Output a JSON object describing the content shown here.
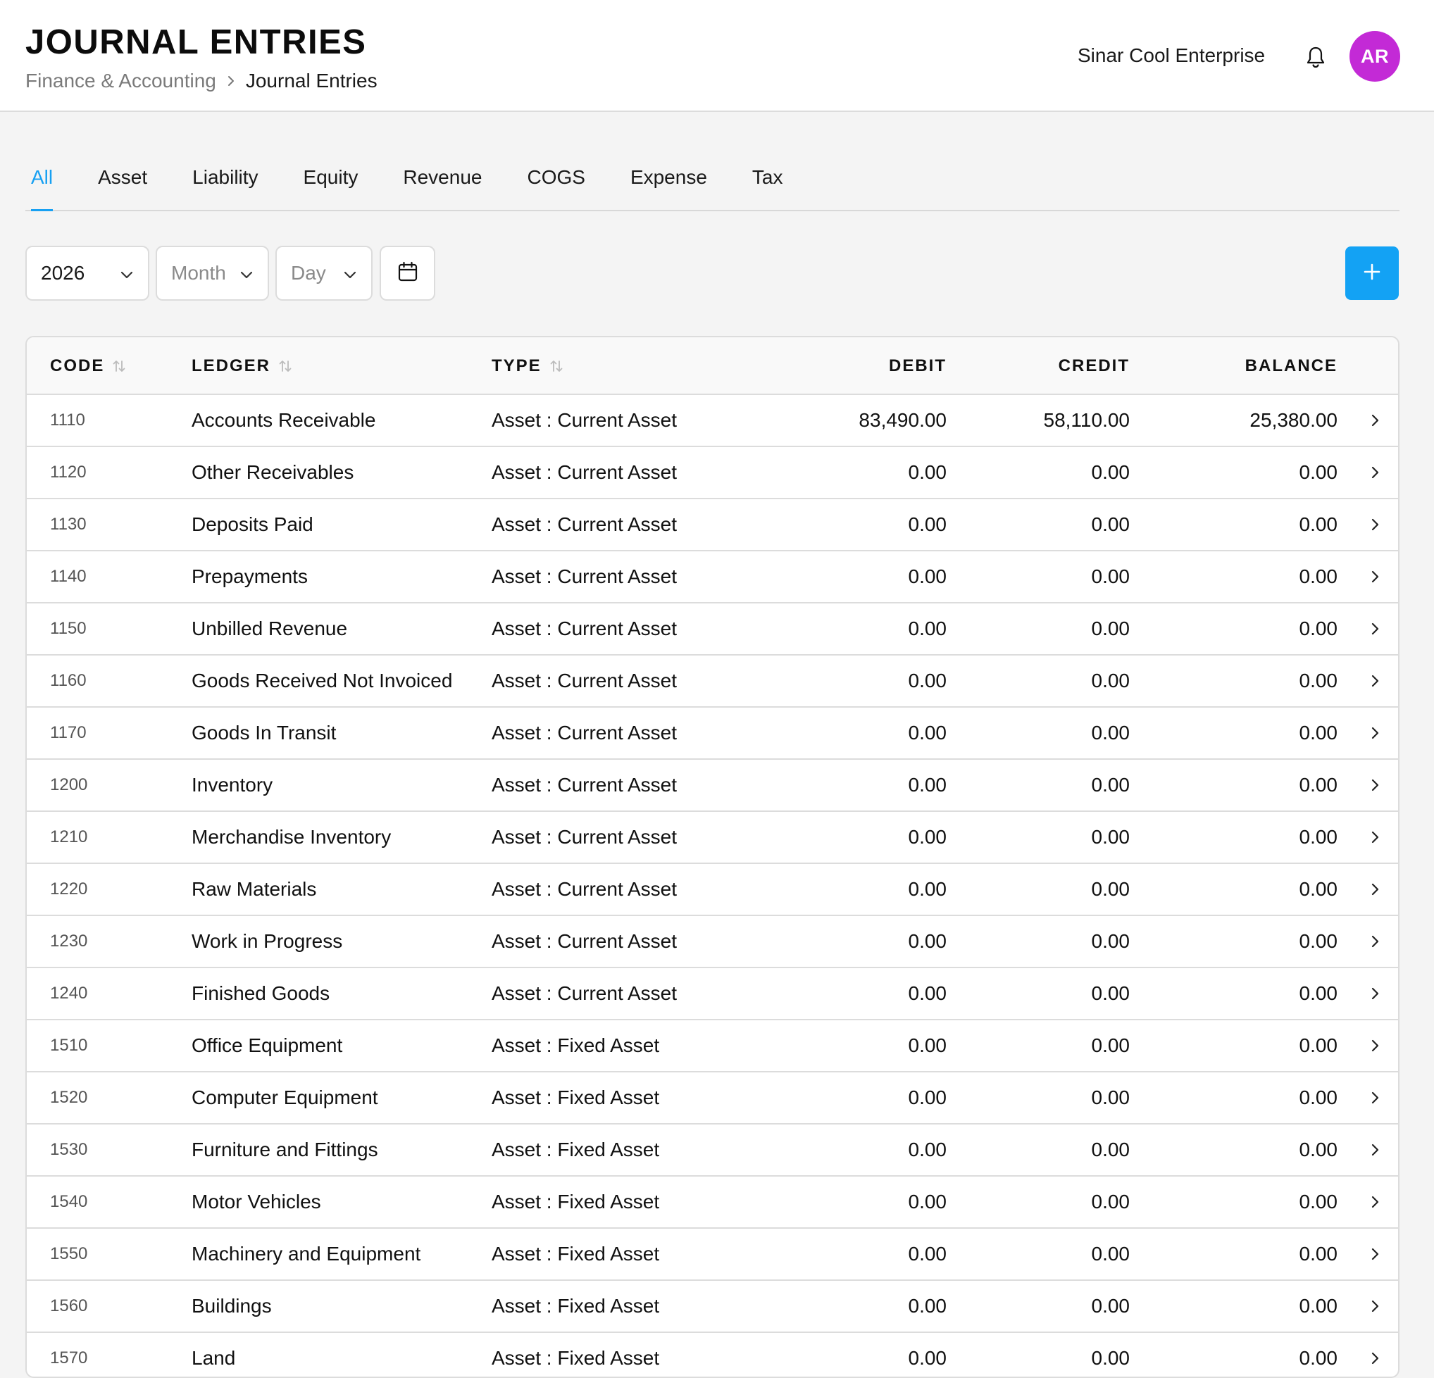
{
  "header": {
    "title": "JOURNAL ENTRIES",
    "breadcrumb": {
      "parent": "Finance & Accounting",
      "current": "Journal Entries"
    },
    "company": "Sinar Cool Enterprise",
    "avatar_initials": "AR",
    "avatar_color": "#c32ad6"
  },
  "tabs": [
    {
      "label": "All",
      "active": true
    },
    {
      "label": "Asset"
    },
    {
      "label": "Liability"
    },
    {
      "label": "Equity"
    },
    {
      "label": "Revenue"
    },
    {
      "label": "COGS"
    },
    {
      "label": "Expense"
    },
    {
      "label": "Tax"
    }
  ],
  "filters": {
    "year": "2026",
    "month_placeholder": "Month",
    "day_placeholder": "Day"
  },
  "accent_color": "#13a2f4",
  "table": {
    "columns": {
      "code": "CODE",
      "ledger": "LEDGER",
      "type": "TYPE",
      "debit": "DEBIT",
      "credit": "CREDIT",
      "balance": "BALANCE"
    },
    "rows": [
      {
        "code": "1110",
        "ledger": "Accounts Receivable",
        "type": "Asset : Current Asset",
        "debit": "83,490.00",
        "credit": "58,110.00",
        "balance": "25,380.00"
      },
      {
        "code": "1120",
        "ledger": "Other Receivables",
        "type": "Asset : Current Asset",
        "debit": "0.00",
        "credit": "0.00",
        "balance": "0.00"
      },
      {
        "code": "1130",
        "ledger": "Deposits Paid",
        "type": "Asset : Current Asset",
        "debit": "0.00",
        "credit": "0.00",
        "balance": "0.00"
      },
      {
        "code": "1140",
        "ledger": "Prepayments",
        "type": "Asset : Current Asset",
        "debit": "0.00",
        "credit": "0.00",
        "balance": "0.00"
      },
      {
        "code": "1150",
        "ledger": "Unbilled Revenue",
        "type": "Asset : Current Asset",
        "debit": "0.00",
        "credit": "0.00",
        "balance": "0.00"
      },
      {
        "code": "1160",
        "ledger": "Goods Received Not Invoiced",
        "type": "Asset : Current Asset",
        "debit": "0.00",
        "credit": "0.00",
        "balance": "0.00"
      },
      {
        "code": "1170",
        "ledger": "Goods In Transit",
        "type": "Asset : Current Asset",
        "debit": "0.00",
        "credit": "0.00",
        "balance": "0.00"
      },
      {
        "code": "1200",
        "ledger": "Inventory",
        "type": "Asset : Current Asset",
        "debit": "0.00",
        "credit": "0.00",
        "balance": "0.00"
      },
      {
        "code": "1210",
        "ledger": "Merchandise Inventory",
        "type": "Asset : Current Asset",
        "debit": "0.00",
        "credit": "0.00",
        "balance": "0.00"
      },
      {
        "code": "1220",
        "ledger": "Raw Materials",
        "type": "Asset : Current Asset",
        "debit": "0.00",
        "credit": "0.00",
        "balance": "0.00"
      },
      {
        "code": "1230",
        "ledger": "Work in Progress",
        "type": "Asset : Current Asset",
        "debit": "0.00",
        "credit": "0.00",
        "balance": "0.00"
      },
      {
        "code": "1240",
        "ledger": "Finished Goods",
        "type": "Asset : Current Asset",
        "debit": "0.00",
        "credit": "0.00",
        "balance": "0.00"
      },
      {
        "code": "1510",
        "ledger": "Office Equipment",
        "type": "Asset : Fixed Asset",
        "debit": "0.00",
        "credit": "0.00",
        "balance": "0.00"
      },
      {
        "code": "1520",
        "ledger": "Computer Equipment",
        "type": "Asset : Fixed Asset",
        "debit": "0.00",
        "credit": "0.00",
        "balance": "0.00"
      },
      {
        "code": "1530",
        "ledger": "Furniture and Fittings",
        "type": "Asset : Fixed Asset",
        "debit": "0.00",
        "credit": "0.00",
        "balance": "0.00"
      },
      {
        "code": "1540",
        "ledger": "Motor Vehicles",
        "type": "Asset : Fixed Asset",
        "debit": "0.00",
        "credit": "0.00",
        "balance": "0.00"
      },
      {
        "code": "1550",
        "ledger": "Machinery and Equipment",
        "type": "Asset : Fixed Asset",
        "debit": "0.00",
        "credit": "0.00",
        "balance": "0.00"
      },
      {
        "code": "1560",
        "ledger": "Buildings",
        "type": "Asset : Fixed Asset",
        "debit": "0.00",
        "credit": "0.00",
        "balance": "0.00"
      },
      {
        "code": "1570",
        "ledger": "Land",
        "type": "Asset : Fixed Asset",
        "debit": "0.00",
        "credit": "0.00",
        "balance": "0.00"
      }
    ]
  }
}
